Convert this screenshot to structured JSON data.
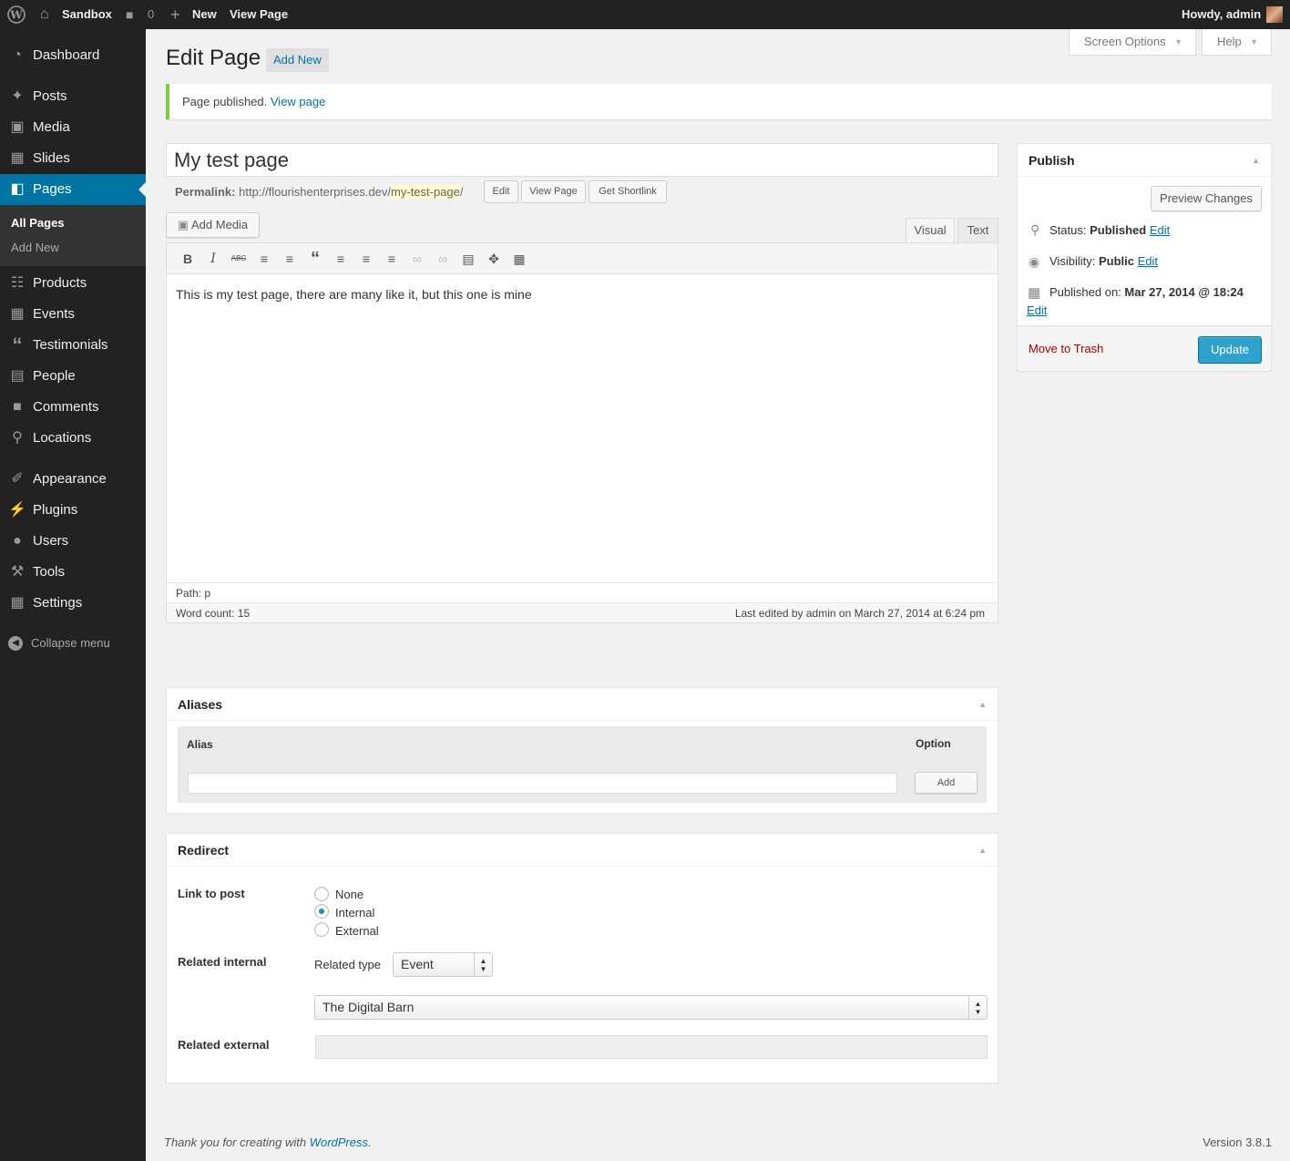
{
  "adminbar": {
    "site_name": "Sandbox",
    "comments_count": "0",
    "new_label": "New",
    "view_page": "View Page",
    "howdy": "Howdy, admin"
  },
  "sidebar": {
    "items": [
      {
        "label": "Dashboard",
        "icon": "dashboard-icon"
      },
      {
        "label": "Posts",
        "icon": "pin-icon"
      },
      {
        "label": "Media",
        "icon": "media-icon"
      },
      {
        "label": "Slides",
        "icon": "slides-icon"
      },
      {
        "label": "Pages",
        "icon": "pages-icon"
      },
      {
        "label": "Products",
        "icon": "cart-icon"
      },
      {
        "label": "Events",
        "icon": "calendar-icon"
      },
      {
        "label": "Testimonials",
        "icon": "quote-icon"
      },
      {
        "label": "People",
        "icon": "people-icon"
      },
      {
        "label": "Comments",
        "icon": "comment-icon"
      },
      {
        "label": "Locations",
        "icon": "location-icon"
      },
      {
        "label": "Appearance",
        "icon": "brush-icon"
      },
      {
        "label": "Plugins",
        "icon": "plug-icon"
      },
      {
        "label": "Users",
        "icon": "user-icon"
      },
      {
        "label": "Tools",
        "icon": "wrench-icon"
      },
      {
        "label": "Settings",
        "icon": "settings-icon"
      }
    ],
    "submenu": [
      "All Pages",
      "Add New"
    ],
    "collapse": "Collapse menu"
  },
  "screen_options": "Screen Options",
  "help": "Help",
  "page": {
    "title": "Edit Page",
    "add_new": "Add New"
  },
  "notice": {
    "text": "Page published.",
    "link": "View page"
  },
  "post": {
    "title": "My test page",
    "permalink_label": "Permalink:",
    "permalink_base": "http://flourishenterprises.dev/",
    "permalink_slug": "my-test-page",
    "permalink_tail": "/",
    "edit_btn": "Edit",
    "view_page_btn": "View Page",
    "shortlink_btn": "Get Shortlink"
  },
  "editor": {
    "add_media": "Add Media",
    "tab_visual": "Visual",
    "tab_text": "Text",
    "content": "This is my test page, there are many like it, but this one is mine",
    "path": "Path: p",
    "word_count": "Word count: 15",
    "last_edited": "Last edited by admin on March 27, 2014 at 6:24 pm"
  },
  "publish": {
    "title": "Publish",
    "preview": "Preview Changes",
    "status_label": "Status:",
    "status_value": "Published",
    "visibility_label": "Visibility:",
    "visibility_value": "Public",
    "published_label": "Published on:",
    "published_value": "Mar 27, 2014 @ 18:24",
    "edit": "Edit",
    "trash": "Move to Trash",
    "update": "Update"
  },
  "aliases": {
    "title": "Aliases",
    "col_alias": "Alias",
    "col_option": "Option",
    "input_value": "",
    "add_btn": "Add"
  },
  "redirect": {
    "title": "Redirect",
    "link_to_post": "Link to post",
    "options": [
      "None",
      "Internal",
      "External"
    ],
    "selected": "Internal",
    "related_internal": "Related internal",
    "related_type_label": "Related type",
    "related_type_value": "Event",
    "related_item_value": "The Digital Barn",
    "related_external": "Related external",
    "related_external_value": ""
  },
  "footer": {
    "thanks": "Thank you for creating with",
    "wp_link": "WordPress",
    "period": ".",
    "version": "Version 3.8.1"
  },
  "colors": {
    "sidebar_bg": "#222222",
    "accent": "#0074a2",
    "update_button": "#2ea2cc",
    "notice_border": "#7ad03a",
    "trash": "#aa0000"
  }
}
